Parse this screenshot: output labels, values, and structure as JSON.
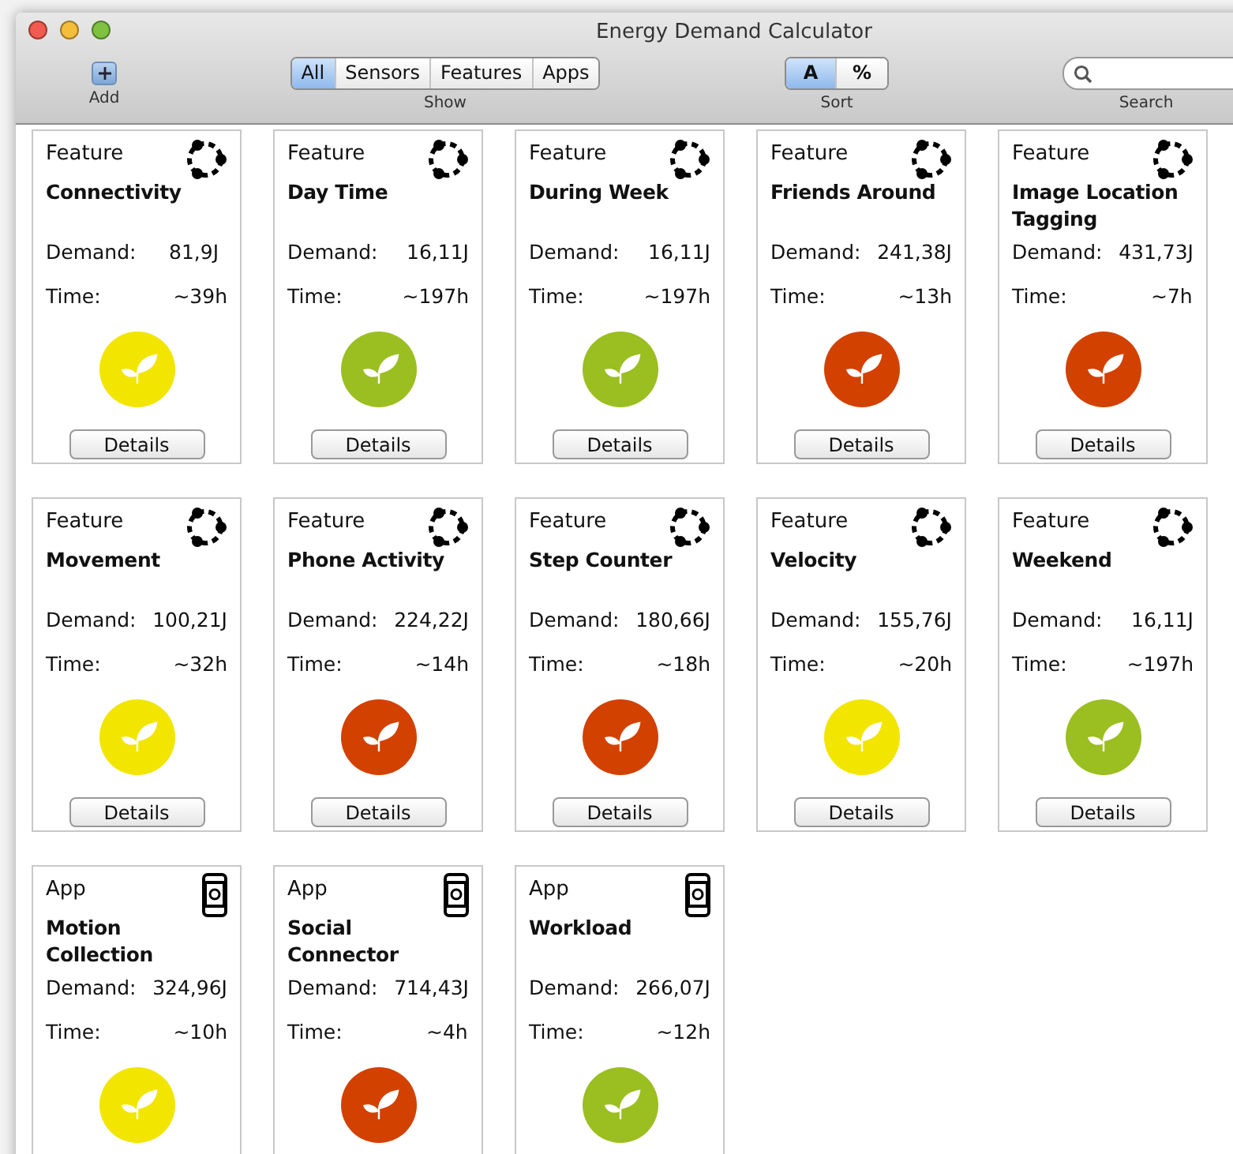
{
  "window": {
    "title": "Energy Demand Calculator"
  },
  "toolbar": {
    "add": {
      "label": "Add"
    },
    "show": {
      "label": "Show",
      "options": [
        {
          "label": "All",
          "selected": true
        },
        {
          "label": "Sensors",
          "selected": false
        },
        {
          "label": "Features",
          "selected": false
        },
        {
          "label": "Apps",
          "selected": false
        }
      ]
    },
    "sort": {
      "label": "Sort",
      "options": [
        {
          "label": "A",
          "selected": true
        },
        {
          "label": "%",
          "selected": false
        }
      ]
    },
    "search": {
      "label": "Search"
    }
  },
  "cards": [
    {
      "kind": "feature",
      "type": "Feature",
      "name": "Connectivity",
      "demand_label": "Demand:",
      "demand": "81,9J",
      "time_label": "Time:",
      "time": "~39h",
      "color": "#f2e500",
      "button": "Details"
    },
    {
      "kind": "feature",
      "type": "Feature",
      "name": "Day Time",
      "demand_label": "Demand:",
      "demand": "16,11J",
      "time_label": "Time:",
      "time": "~197h",
      "color": "#9bbe21",
      "button": "Details"
    },
    {
      "kind": "feature",
      "type": "Feature",
      "name": "During Week",
      "demand_label": "Demand:",
      "demand": "16,11J",
      "time_label": "Time:",
      "time": "~197h",
      "color": "#9bbe21",
      "button": "Details"
    },
    {
      "kind": "feature",
      "type": "Feature",
      "name": "Friends Around",
      "demand_label": "Demand:",
      "demand": "241,38J",
      "time_label": "Time:",
      "time": "~13h",
      "color": "#d24100",
      "button": "Details"
    },
    {
      "kind": "feature",
      "type": "Feature",
      "name": "Image Location Tagging",
      "demand_label": "Demand:",
      "demand": "431,73J",
      "time_label": "Time:",
      "time": "~7h",
      "color": "#d24100",
      "button": "Details"
    },
    {
      "kind": "feature",
      "type": "Feature",
      "name": "Movement",
      "demand_label": "Demand:",
      "demand": "100,21J",
      "time_label": "Time:",
      "time": "~32h",
      "color": "#f2e500",
      "button": "Details"
    },
    {
      "kind": "feature",
      "type": "Feature",
      "name": "Phone Activity",
      "demand_label": "Demand:",
      "demand": "224,22J",
      "time_label": "Time:",
      "time": "~14h",
      "color": "#d24100",
      "button": "Details"
    },
    {
      "kind": "feature",
      "type": "Feature",
      "name": "Step Counter",
      "demand_label": "Demand:",
      "demand": "180,66J",
      "time_label": "Time:",
      "time": "~18h",
      "color": "#d24100",
      "button": "Details"
    },
    {
      "kind": "feature",
      "type": "Feature",
      "name": "Velocity",
      "demand_label": "Demand:",
      "demand": "155,76J",
      "time_label": "Time:",
      "time": "~20h",
      "color": "#f2e500",
      "button": "Details"
    },
    {
      "kind": "feature",
      "type": "Feature",
      "name": "Weekend",
      "demand_label": "Demand:",
      "demand": "16,11J",
      "time_label": "Time:",
      "time": "~197h",
      "color": "#9bbe21",
      "button": "Details"
    },
    {
      "kind": "app",
      "type": "App",
      "name": "Motion Collection",
      "demand_label": "Demand:",
      "demand": "324,96J",
      "time_label": "Time:",
      "time": "~10h",
      "color": "#f2e500"
    },
    {
      "kind": "app",
      "type": "App",
      "name": "Social Connector",
      "demand_label": "Demand:",
      "demand": "714,43J",
      "time_label": "Time:",
      "time": "~4h",
      "color": "#d24100"
    },
    {
      "kind": "app",
      "type": "App",
      "name": "Workload",
      "demand_label": "Demand:",
      "demand": "266,07J",
      "time_label": "Time:",
      "time": "~12h",
      "color": "#9bbe21"
    }
  ]
}
